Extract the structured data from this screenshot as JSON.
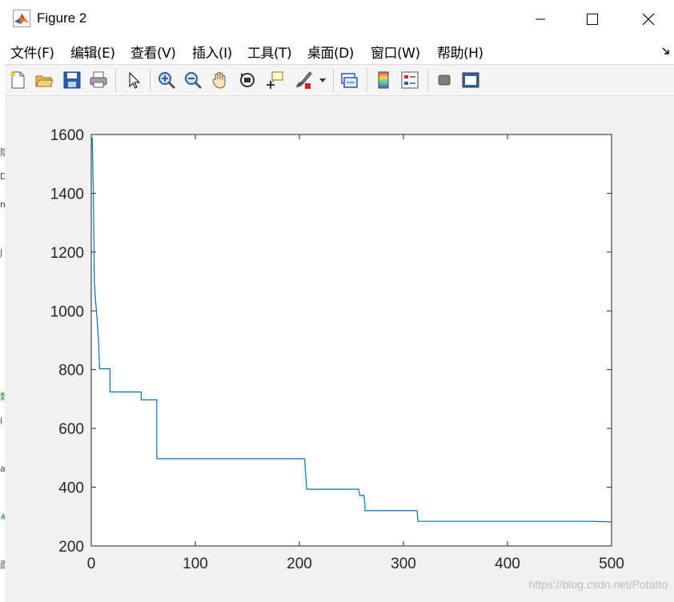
{
  "window": {
    "title": "Figure 2",
    "buttons": [
      "minimize",
      "maximize",
      "close"
    ]
  },
  "menu": {
    "items": [
      {
        "label": "文件(F)"
      },
      {
        "label": "编辑(E)"
      },
      {
        "label": "查看(V)"
      },
      {
        "label": "插入(I)"
      },
      {
        "label": "工具(T)"
      },
      {
        "label": "桌面(D)"
      },
      {
        "label": "窗口(W)"
      },
      {
        "label": "帮助(H)"
      }
    ]
  },
  "toolbar": {
    "tools": [
      "new-figure-icon",
      "open-file-icon",
      "save-icon",
      "print-icon",
      "pointer-icon",
      "zoom-in-icon",
      "zoom-out-icon",
      "pan-hand-icon",
      "rotate-3d-icon",
      "data-cursor-icon",
      "brush-icon",
      "dropdown-arrow-icon",
      "link-plot-icon",
      "colorbar-icon",
      "legend-icon",
      "hide-plot-tools-icon",
      "show-plot-tools-icon"
    ]
  },
  "chart_data": {
    "type": "line",
    "title": "",
    "xlabel": "",
    "ylabel": "",
    "xlim": [
      0,
      500
    ],
    "ylim": [
      200,
      1600
    ],
    "xticks": [
      "0",
      "100",
      "200",
      "300",
      "400",
      "500"
    ],
    "yticks": [
      "200",
      "400",
      "600",
      "800",
      "1000",
      "1200",
      "1400",
      "1600"
    ],
    "grid": false,
    "legend": "none",
    "series": [
      {
        "color": "#0072bd",
        "x": [
          1,
          2,
          3,
          4,
          5,
          6,
          7,
          8,
          8,
          18,
          18,
          48,
          48,
          63,
          63,
          205,
          207,
          207,
          257,
          258,
          262,
          263,
          263,
          313,
          314,
          314,
          480,
          500
        ],
        "y": [
          1590,
          1400,
          1100,
          1040,
          1000,
          950,
          900,
          803,
          803,
          803,
          724,
          724,
          697,
          697,
          497,
          497,
          395,
          393,
          393,
          372,
          372,
          345,
          320,
          320,
          285,
          284,
          284,
          282
        ]
      }
    ]
  },
  "watermark": "https://blog.csdn.net/Potatto"
}
